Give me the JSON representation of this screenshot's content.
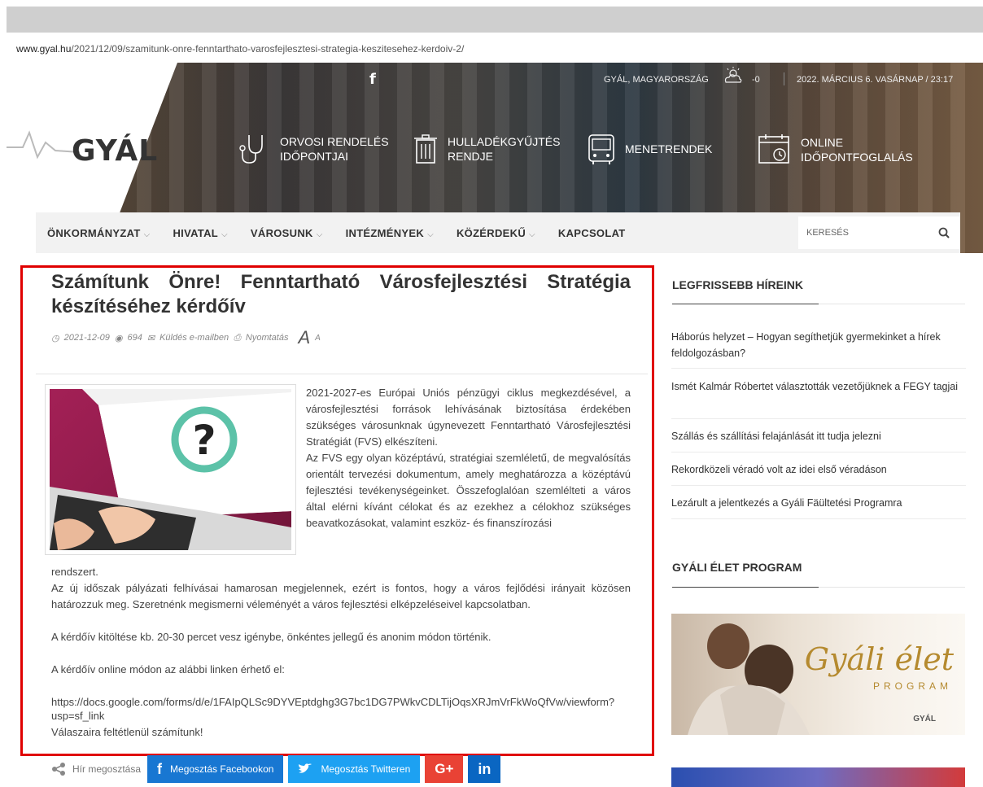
{
  "browser": {
    "url_host": "www.gyal.hu",
    "url_path": "/2021/12/09/szamitunk-onre-fenntarthato-varosfejlesztesi-strategia-keszitesehez-kerdoiv-2/"
  },
  "header": {
    "logo": "GYÁL",
    "location": "GYÁL, MAGYARORSZÁG",
    "temperature": "-0",
    "datetime": "2022. MÁRCIUS 6. VASÁRNAP / 23:17",
    "tiles": [
      {
        "line1": "ORVOSI RENDELÉS",
        "line2": "IDŐPONTJAI"
      },
      {
        "line1": "HULLADÉKGYŰJTÉS",
        "line2": "RENDJE"
      },
      {
        "line1": "MENETRENDEK",
        "line2": ""
      },
      {
        "line1": "ONLINE",
        "line2": "IDŐPONTFOGLALÁS"
      }
    ]
  },
  "nav": {
    "items": [
      "ÖNKORMÁNYZAT",
      "HIVATAL",
      "VÁROSUNK",
      "INTÉZMÉNYEK",
      "KÖZÉRDEKŰ",
      "KAPCSOLAT"
    ],
    "search_placeholder": "KERESÉS"
  },
  "article": {
    "title": "Számítunk Önre! Fenntartható Városfejlesztési Stratégia készítéséhez kérdőív",
    "date": "2021-12-09",
    "views": "694",
    "email_label": "Küldés e-mailben",
    "print_label": "Nyomtatás",
    "font_big": "A",
    "font_small": "A",
    "para1_wrap": "2021-2027-es Európai Uniós pénzügyi ciklus megkezdésével, a városfejlesztési források lehívásának biztosítása érdekében szükséges városunknak úgynevezett Fenntartható Városfejlesztési Stratégiát (FVS) elkészíteni.",
    "para2_wrap": "Az FVS egy olyan középtávú, stratégiai szemléletű, de megvalósítás orientált tervezési dokumentum, amely meghatározza a középtávú fejlesztési tevékenységeinket. Összefoglalóan szemlélteti a város által elérni kívánt célokat és az ezekhez a célokhoz szükséges beavatkozásokat, valamint eszköz- és finanszírozási",
    "para2_tail": "rendszert.",
    "para3": "Az új időszak pályázati felhívásai hamarosan megjelennek, ezért is fontos, hogy a város fejlődési irányait közösen határozzuk meg. Szeretnénk megismerni véleményét a város fejlesztési elképzeléseivel kapcsolatban.",
    "para4": "A kérdőív kitöltése kb. 20-30 percet vesz igénybe, önkéntes jellegű és anonim módon történik.",
    "para5": "A kérdőív online módon az alábbi linken érhető el:",
    "link_line1": "https://docs.google.com/forms/d/e/1FAIpQLSc9DYVEptdghg3G7bc1DG7PWkvCDLTijOqsXRJmVrFkWoQfVw/viewform?",
    "link_line2": "usp=sf_link",
    "closing": "Válaszaira feltétlenül számítunk!"
  },
  "share": {
    "label": "Hír megosztása",
    "facebook": "Megosztás Facebookon",
    "twitter": "Megosztás Twitteren",
    "gplus": "G+",
    "linkedin": "in"
  },
  "sidebar": {
    "latest_title": "LEGFRISSEBB HÍREINK",
    "news": [
      "Háborús helyzet – Hogyan segíthetjük gyermekinket a hírek feldolgozásban?",
      "Ismét Kalmár Róbertet választották vezetőjüknek a FEGY tagjai",
      "Szállás és szállítási felajánlását itt tudja jelezni",
      "Rekordközeli véradó volt az idei első véradáson",
      "Lezárult a jelentkezés a Gyáli Fäültetési Programra"
    ],
    "program_title": "GYÁLI ÉLET PROGRAM",
    "banner_script": "Gyáli élet",
    "banner_sub": "PROGRAM",
    "banner_logo": "GYÁL"
  },
  "colors": {
    "highlight_frame": "#e00000",
    "facebook": "#1877d2",
    "twitter": "#1da1f2",
    "gplus": "#e94235",
    "linkedin": "#0a66c2"
  }
}
